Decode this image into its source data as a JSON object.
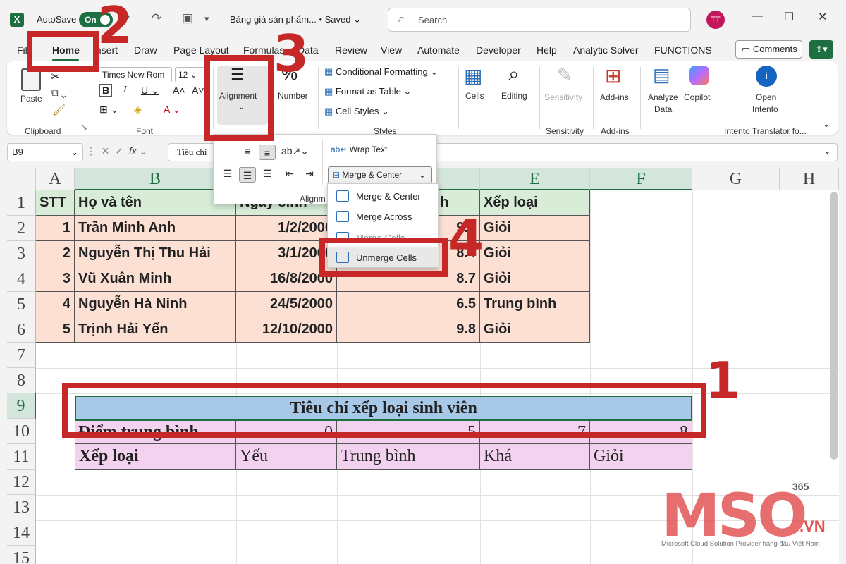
{
  "titlebar": {
    "autosave_label": "AutoSave",
    "toggle_label": "On",
    "doc_title": "Bảng giá sản phẩm... • Saved ⌄",
    "search_placeholder": "Search",
    "avatar_initials": "TT"
  },
  "tabs": [
    "File",
    "Home",
    "Insert",
    "Draw",
    "Page Layout",
    "Formulas",
    "Data",
    "Review",
    "View",
    "Automate",
    "Developer",
    "Help",
    "Analytic Solver",
    "FUNCTIONS"
  ],
  "comments_label": "Comments",
  "ribbon": {
    "paste": "Paste",
    "clipboard_group": "Clipboard",
    "font_name": "Times New Rom",
    "font_size": "12",
    "font_group": "Font",
    "alignment": "Alignment",
    "number": "Number",
    "conditional_formatting": "Conditional Formatting ⌄",
    "format_as_table": "Format as Table ⌄",
    "cell_styles": "Cell Styles ⌄",
    "styles_group": "Styles",
    "cells": "Cells",
    "editing": "Editing",
    "sensitivity": "Sensitivity",
    "sensitivity_group": "Sensitivity",
    "addins": "Add-ins",
    "addins_group": "Add-ins",
    "analyze_data_1": "Analyze",
    "analyze_data_2": "Data",
    "copilot": "Copilot",
    "open_intento_1": "Open",
    "open_intento_2": "Intento",
    "intento_group": "Intento Translator fo..."
  },
  "formula_bar": {
    "name_box": "B9",
    "formula": "Tiêu chí"
  },
  "alignment_panel": {
    "wrap_text": "Wrap Text",
    "merge_center_btn": "Merge & Center",
    "group_label": "Alignm",
    "menu_items": [
      "Merge & Center",
      "Merge Across",
      "Merge Cells",
      "Unmerge Cells"
    ]
  },
  "sheet": {
    "columns": [
      "A",
      "B",
      "C",
      "D",
      "E",
      "F",
      "G",
      "H"
    ],
    "rows": [
      "1",
      "2",
      "3",
      "4",
      "5",
      "6",
      "7",
      "8",
      "9",
      "10",
      "11",
      "12",
      "13",
      "14",
      "15"
    ],
    "header": [
      "STT",
      "Họ và tên",
      "Ngày sinh",
      "Điểm trung bình",
      "Xếp loại"
    ],
    "students": [
      [
        "1",
        "Trần Minh Anh",
        "1/2/2000",
        "9.0",
        "Giỏi"
      ],
      [
        "2",
        "Nguyễn Thị Thu Hải",
        "3/1/2000",
        "8.4",
        "Giỏi"
      ],
      [
        "3",
        "Vũ Xuân Minh",
        "16/8/2000",
        "8.7",
        "Giỏi"
      ],
      [
        "4",
        "Nguyễn Hà Ninh",
        "24/5/2000",
        "6.5",
        "Trung bình"
      ],
      [
        "5",
        "Trịnh Hải Yến",
        "12/10/2000",
        "9.8",
        "Giỏi"
      ]
    ],
    "criteria_title": "Tiêu chí xếp loại sinh viên",
    "criteria_row10": [
      "Điểm trung bình",
      "0",
      "5",
      "7",
      "8"
    ],
    "criteria_row11": [
      "Xếp loại",
      "Yếu",
      "Trung bình",
      "Khá",
      "Giỏi"
    ]
  },
  "annotations": [
    "1",
    "2",
    "3",
    "4"
  ],
  "watermark": {
    "brand": "MSO",
    "badge": "365",
    "domain": ".VN",
    "tagline": "Microsoft Cloud Solution Provider hàng đầu Việt Nam"
  },
  "colors": {
    "excel_green": "#1d6f42",
    "header_fill": "#d8ecd8",
    "body_fill": "#fce0d4",
    "merged_fill": "#a8c8e8",
    "criteria_fill": "#f3d2ef",
    "annotation_red": "#c62828"
  }
}
